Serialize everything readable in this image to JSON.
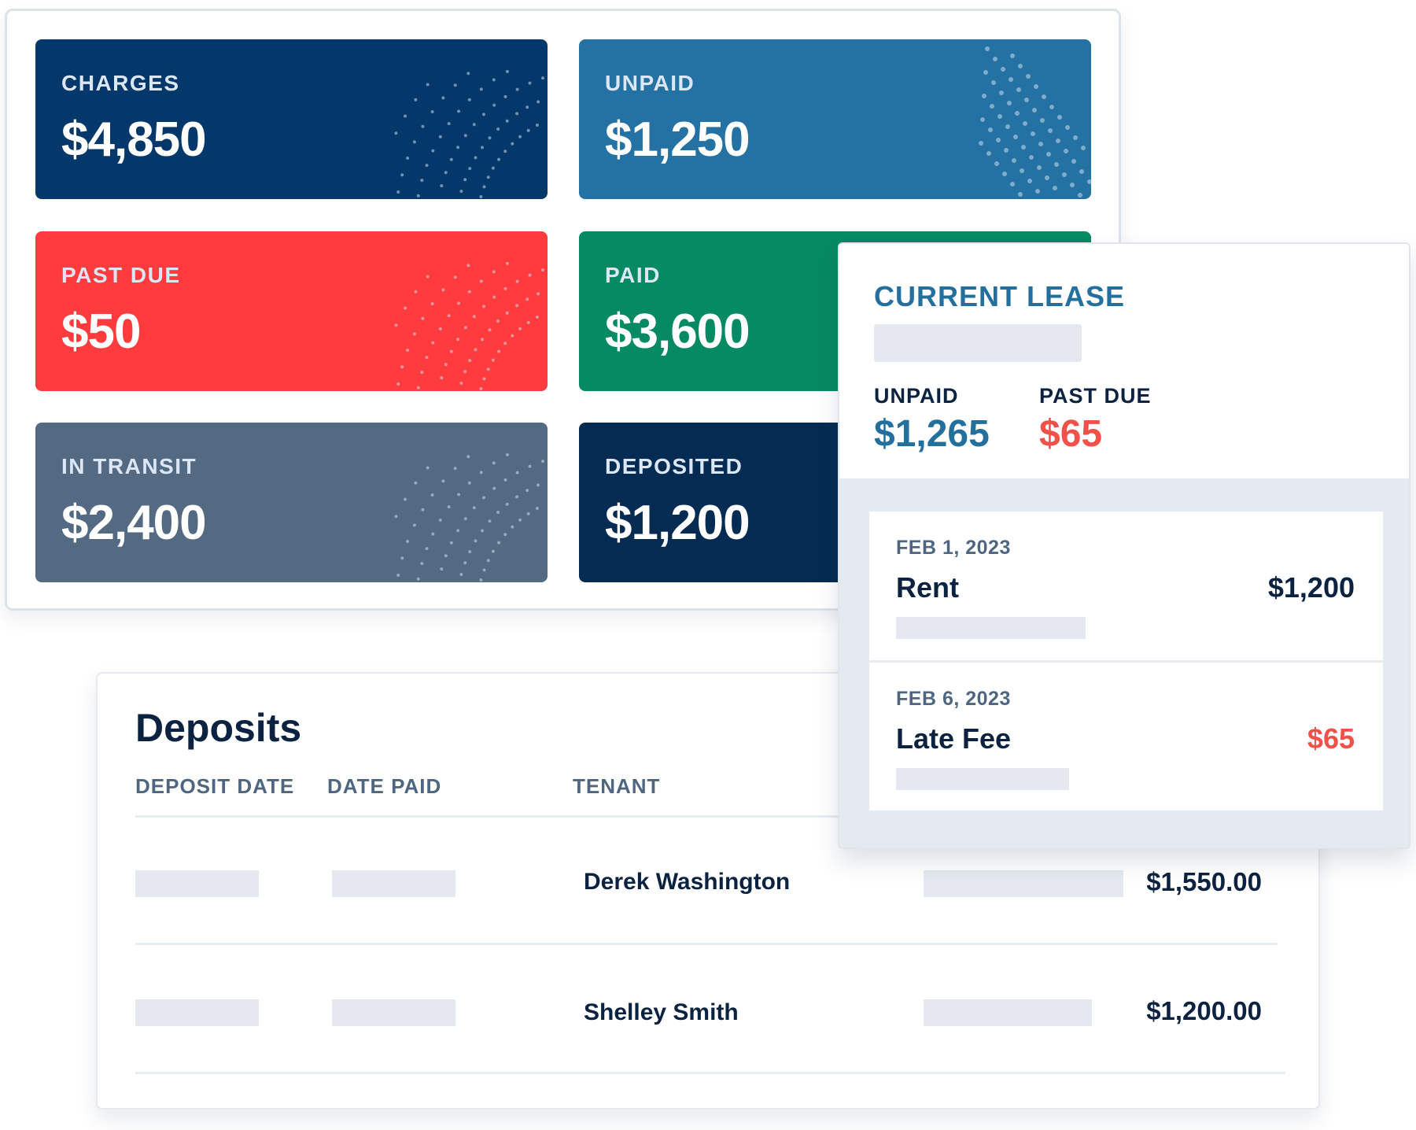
{
  "summary": {
    "cards": [
      {
        "label": "CHARGES",
        "value": "$4,850",
        "color": "#04386a"
      },
      {
        "label": "UNPAID",
        "value": "$1,250",
        "color": "#2471a3"
      },
      {
        "label": "PAST DUE",
        "value": "$50",
        "color": "#ff3b3d"
      },
      {
        "label": "PAID",
        "value": "$3,600",
        "color": "#068a63"
      },
      {
        "label": "IN TRANSIT",
        "value": "$2,400",
        "color": "#546a82"
      },
      {
        "label": "DEPOSITED",
        "value": "$1,200",
        "color": "#042c52"
      }
    ]
  },
  "deposits": {
    "title": "Deposits",
    "columns": [
      "DEPOSIT DATE",
      "DATE PAID",
      "TENANT"
    ],
    "rows": [
      {
        "tenant": "Derek Washington",
        "amount": "$1,550.00"
      },
      {
        "tenant": "Shelley Smith",
        "amount": "$1,200.00"
      }
    ]
  },
  "lease": {
    "title": "CURRENT LEASE",
    "unpaid_label": "UNPAID",
    "unpaid_value": "$1,265",
    "past_due_label": "PAST DUE",
    "past_due_value": "$65",
    "charges": [
      {
        "date": "FEB 1, 2023",
        "name": "Rent",
        "amount": "$1,200",
        "amount_color": "#0b2340"
      },
      {
        "date": "FEB 6, 2023",
        "name": "Late Fee",
        "amount": "$65",
        "amount_color": "#f0524a"
      }
    ]
  },
  "colors": {
    "accent_blue": "#23709f",
    "alert_red": "#f0524a",
    "ink": "#0b2340"
  }
}
